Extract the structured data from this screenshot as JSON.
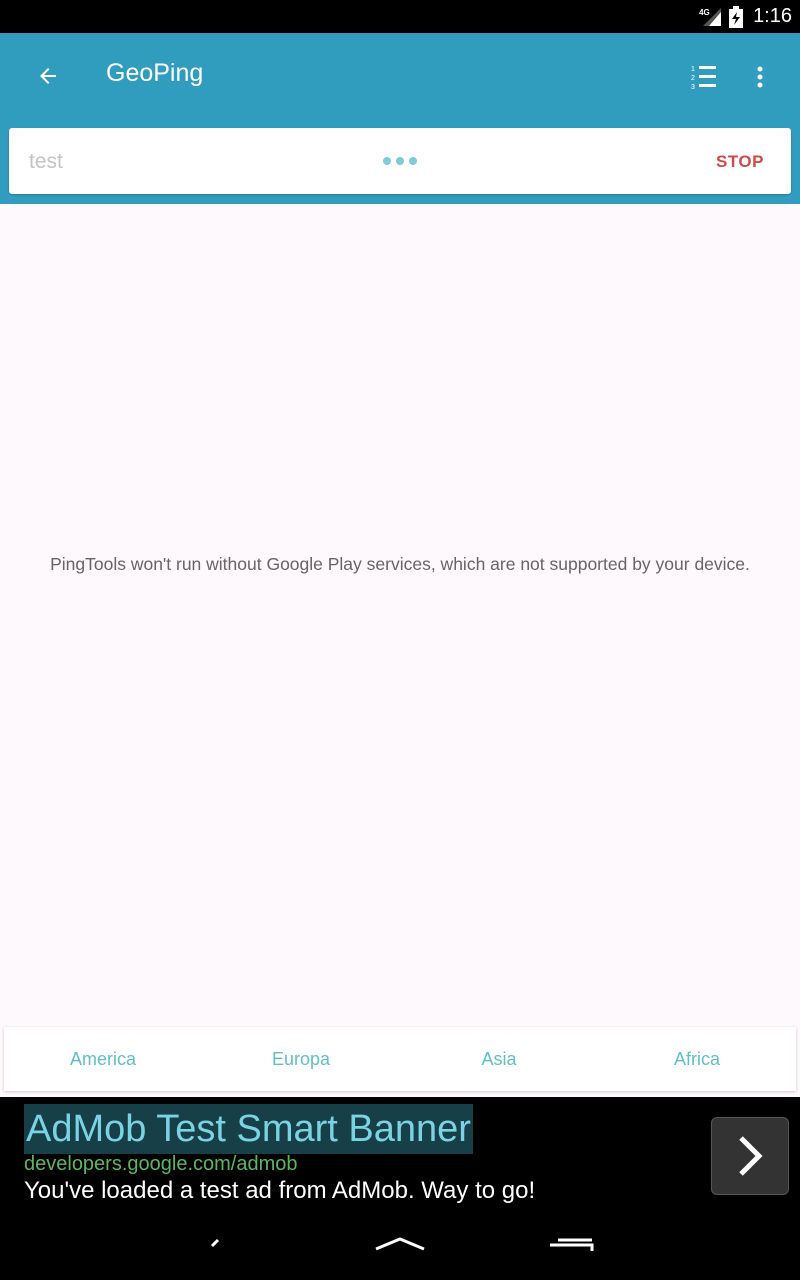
{
  "status_bar": {
    "network_label": "4G",
    "time": "1:16"
  },
  "toolbar": {
    "title": "GeoPing"
  },
  "search": {
    "value": "",
    "placeholder": "test",
    "stop_label": "STOP"
  },
  "content": {
    "message": "PingTools won't run without Google Play services, which are not supported by your device."
  },
  "region_tabs": [
    "America",
    "Europa",
    "Asia",
    "Africa"
  ],
  "ad": {
    "title": "AdMob Test Smart Banner",
    "url": "developers.google.com/admob",
    "body": "You've loaded a test ad from AdMob. Way to go!"
  },
  "colors": {
    "app_bar": "#319DBE",
    "stop": "#d14a46",
    "tab_text": "#5fc0c9",
    "content_bg": "#FDF9FC"
  }
}
